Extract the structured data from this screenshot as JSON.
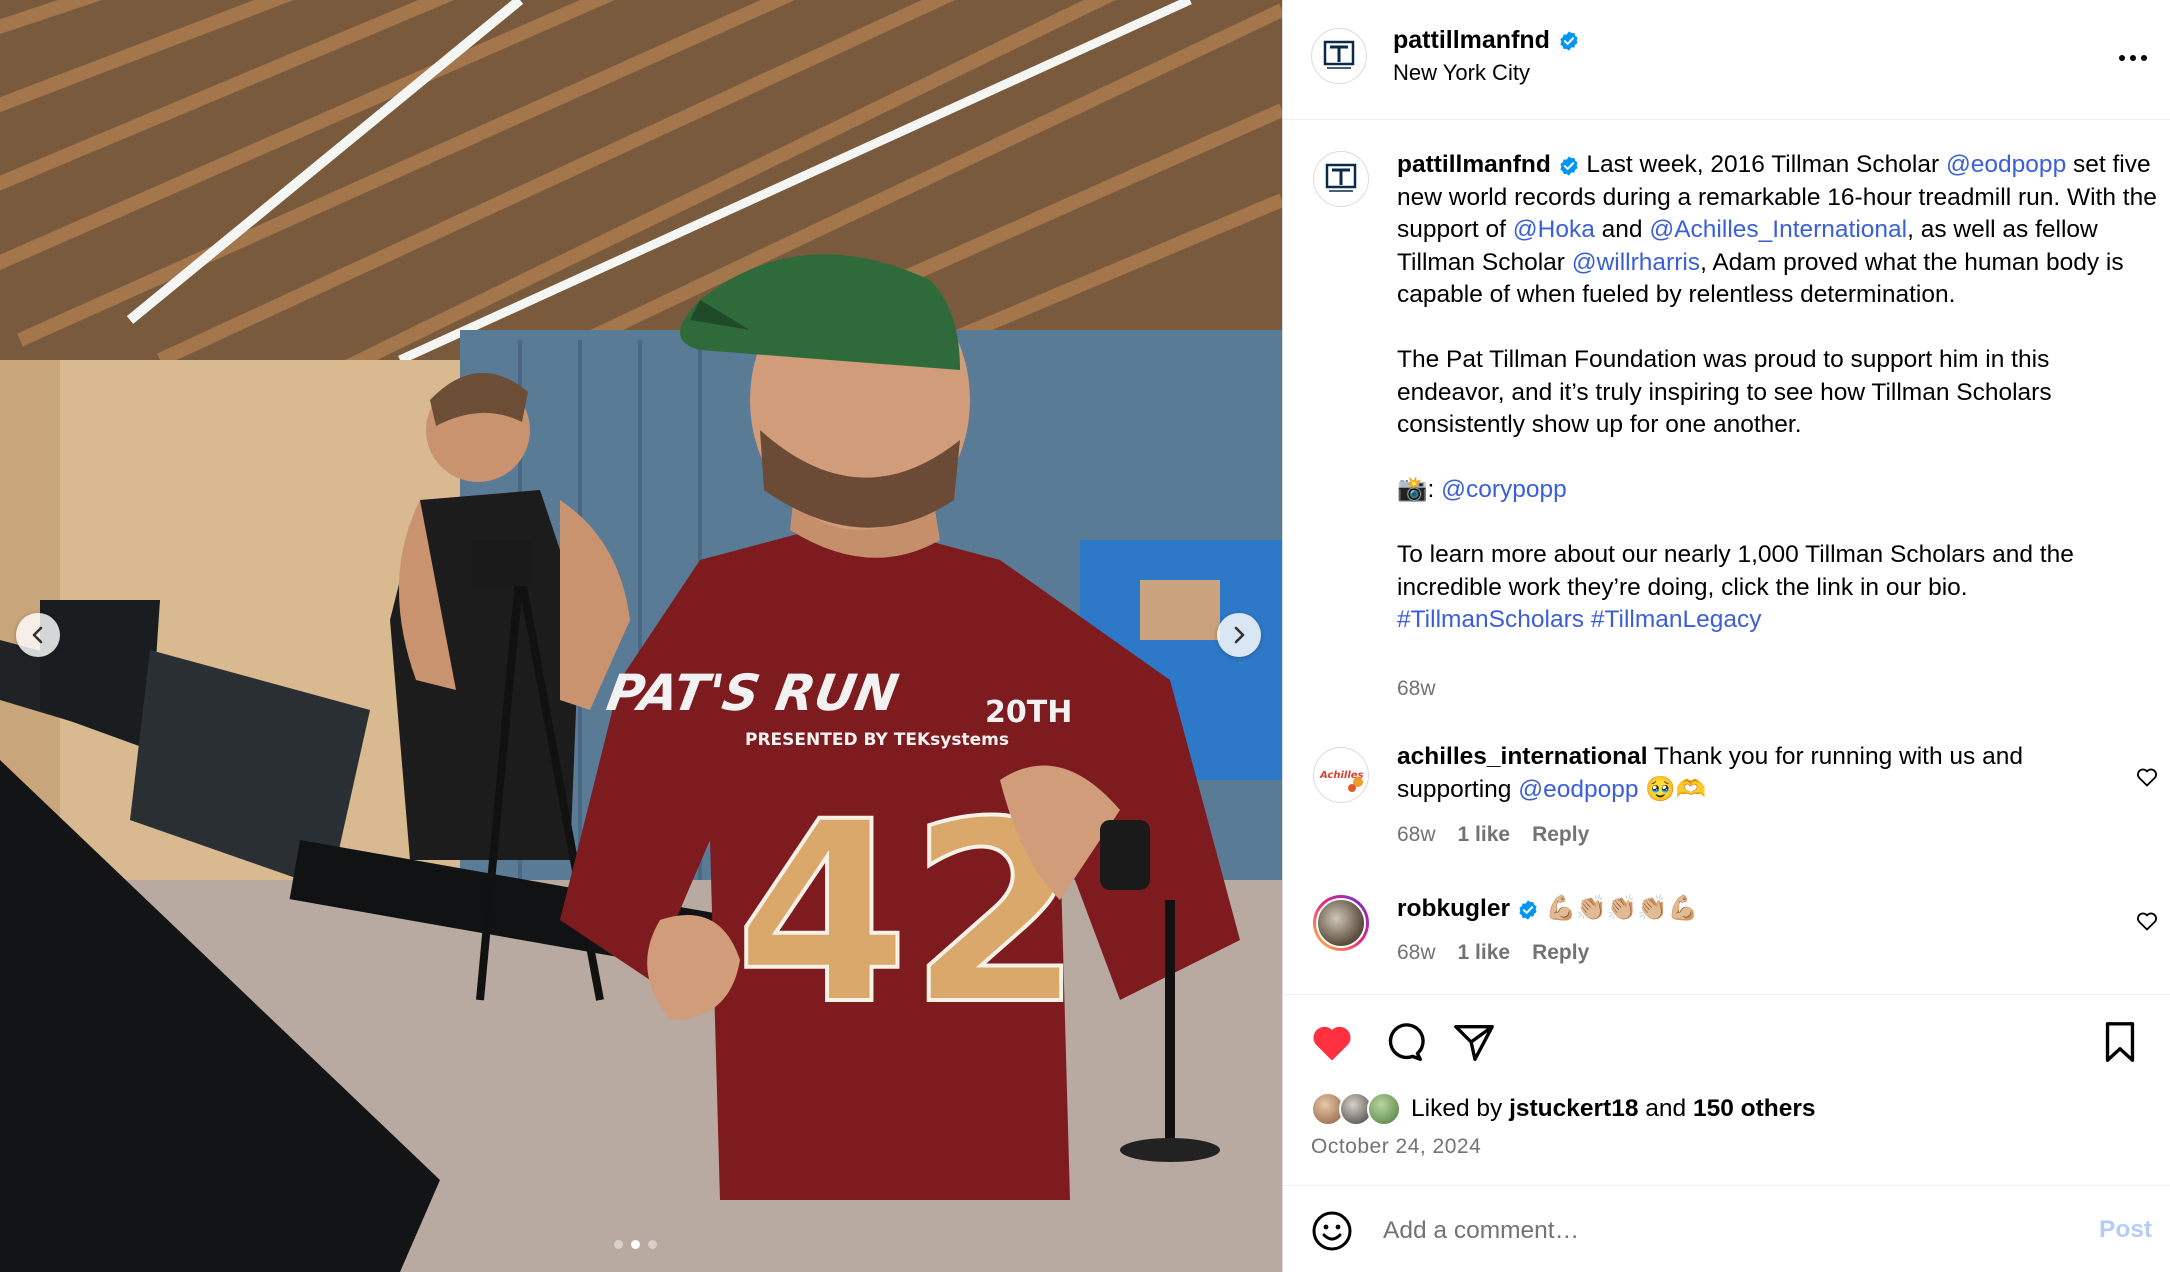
{
  "post": {
    "username": "pattillmanfnd",
    "location": "New York City",
    "caption": {
      "author": "pattillmanfnd",
      "p1_a": " Last week, 2016 Tillman Scholar ",
      "mention_eodpopp": "@eodpopp",
      "p1_b": " set five new world records during a remarkable 16-hour treadmill run. With the support of ",
      "mention_hoka": "@Hoka",
      "p1_c": " and ",
      "mention_achilles": "@Achilles_International",
      "p1_d": ", as well as fellow Tillman Scholar ",
      "mention_willr": "@willrharris",
      "p1_e": ", Adam proved what the human body is capable of when fueled by relentless determination.",
      "p2": "The Pat Tillman Foundation was proud to support him in this endeavor, and it’s truly inspiring to see how Tillman Scholars consistently show up for one another.",
      "p3_prefix": "📸: ",
      "mention_cory": "@corypopp",
      "p4": "To learn more about our nearly 1,000 Tillman Scholars and the incredible work they’re doing, click the link in our bio.",
      "tag1": "#TillmanScholars",
      "tag2": "#TillmanLegacy"
    },
    "caption_time": "68w"
  },
  "comments": [
    {
      "username": "achilles_international",
      "text_a": " Thank you for running with us and supporting ",
      "mention": "@eodpopp",
      "text_b": " 🥹🫶",
      "time": "68w",
      "likes": "1 like",
      "reply": "Reply"
    },
    {
      "username": "robkugler",
      "text": " 💪🏼👏🏼👏🏼👏🏼💪🏼",
      "time": "68w",
      "likes": "1 like",
      "reply": "Reply"
    }
  ],
  "engagement": {
    "liked_by_prefix": "Liked by ",
    "liked_by_user": "jstuckert18",
    "and": " and ",
    "others": "150 others",
    "date": "October 24, 2024"
  },
  "composer": {
    "placeholder": "Add a comment…",
    "post_label": "Post"
  },
  "carousel": {
    "slide_count": 3,
    "active_index": 1
  },
  "colors": {
    "link": "#3a5fd9",
    "verified": "#0095f6",
    "like_red": "#ff3040",
    "muted": "#737373"
  },
  "icons": {
    "more": "more-options-icon",
    "like": "heart-filled-icon",
    "comment": "comment-icon",
    "share": "share-icon",
    "save": "bookmark-icon",
    "emoji": "emoji-icon"
  },
  "photo": {
    "shirt_text": "PAT'S RUN",
    "shirt_20th": "20TH",
    "shirt_sub": "PRESENTED BY TEKsystems",
    "shirt_number": "42"
  }
}
